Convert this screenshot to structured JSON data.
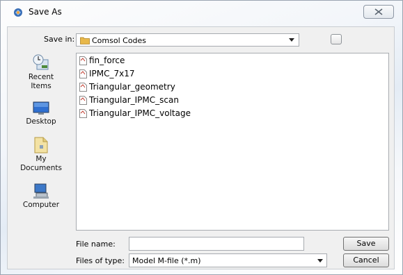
{
  "window": {
    "title": "Save As"
  },
  "save_in": {
    "label": "Save in:",
    "value": "Comsol Codes"
  },
  "places": [
    {
      "label": "Recent\nItems",
      "icon": "recent-items-icon"
    },
    {
      "label": "Desktop",
      "icon": "desktop-icon"
    },
    {
      "label": "My\nDocuments",
      "icon": "my-documents-icon"
    },
    {
      "label": "Computer",
      "icon": "computer-icon"
    }
  ],
  "files": [
    {
      "name": "fin_force"
    },
    {
      "name": "IPMC_7x17"
    },
    {
      "name": "Triangular_geometry"
    },
    {
      "name": "Triangular_IPMC_scan"
    },
    {
      "name": "Triangular_IPMC_voltage"
    }
  ],
  "file_name": {
    "label": "File name:",
    "value": ""
  },
  "file_type": {
    "label": "Files of type:",
    "value": "Model M-file (*.m)"
  },
  "buttons": {
    "save": "Save",
    "cancel": "Cancel"
  },
  "colors": {
    "folder": "#e8b84a",
    "accent": "#3a6fb6"
  }
}
